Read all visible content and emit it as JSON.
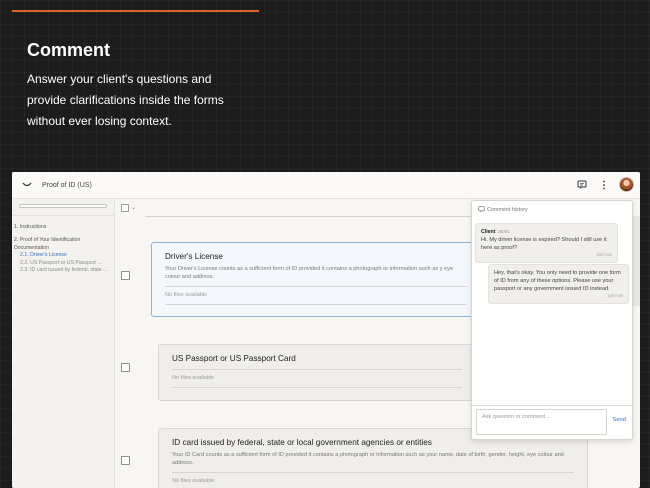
{
  "hero": {
    "title": "Comment",
    "description": "Answer your client's questions and provide clarifications inside the forms without ever losing context."
  },
  "app": {
    "document_title": "Proof of ID (US)",
    "sidebar": {
      "items": [
        {
          "label": "1. Instructions"
        },
        {
          "label": "2. Proof of Your Identification Documentation"
        }
      ],
      "subitems": [
        {
          "label": "2.1. Driver's License",
          "active": true
        },
        {
          "label": "2.2. US Passport or US Passport ...",
          "active": false
        },
        {
          "label": "2.3. ID card issued by federal, state ...",
          "active": false
        }
      ]
    },
    "cards": [
      {
        "title": "Driver's License",
        "description": "Your Driver's License counts as a sufficient form of ID provided it contains a photograph or information such as y eye colour and address.",
        "files": "No files available"
      },
      {
        "title": "US Passport or US Passport Card",
        "files": "No files available"
      },
      {
        "title": "ID card issued by federal, state or local government agencies or entities",
        "description": "Your ID Card counts as a sufficient form of ID provided it contains a photograph or information such as your name, date of birth, gender, height, eye colour and address.",
        "files": "No files available"
      }
    ],
    "comments": {
      "header": "Comment history",
      "messages": [
        {
          "author": "Client",
          "id": "J8091",
          "text": "Hi. My driver license is expired? Should I still use it here as proof?",
          "time": "just now"
        },
        {
          "text": "Hey, that's okay. You only need to provide one form of ID from any of these options. Please use your passport or any government issued ID instead.",
          "time": "just now"
        }
      ],
      "input_placeholder": "Ask question or comment...",
      "send_label": "Send"
    }
  },
  "colors": {
    "accent": "#d9622b",
    "link": "#3a73c4",
    "selected_border": "#8cb4d8"
  }
}
